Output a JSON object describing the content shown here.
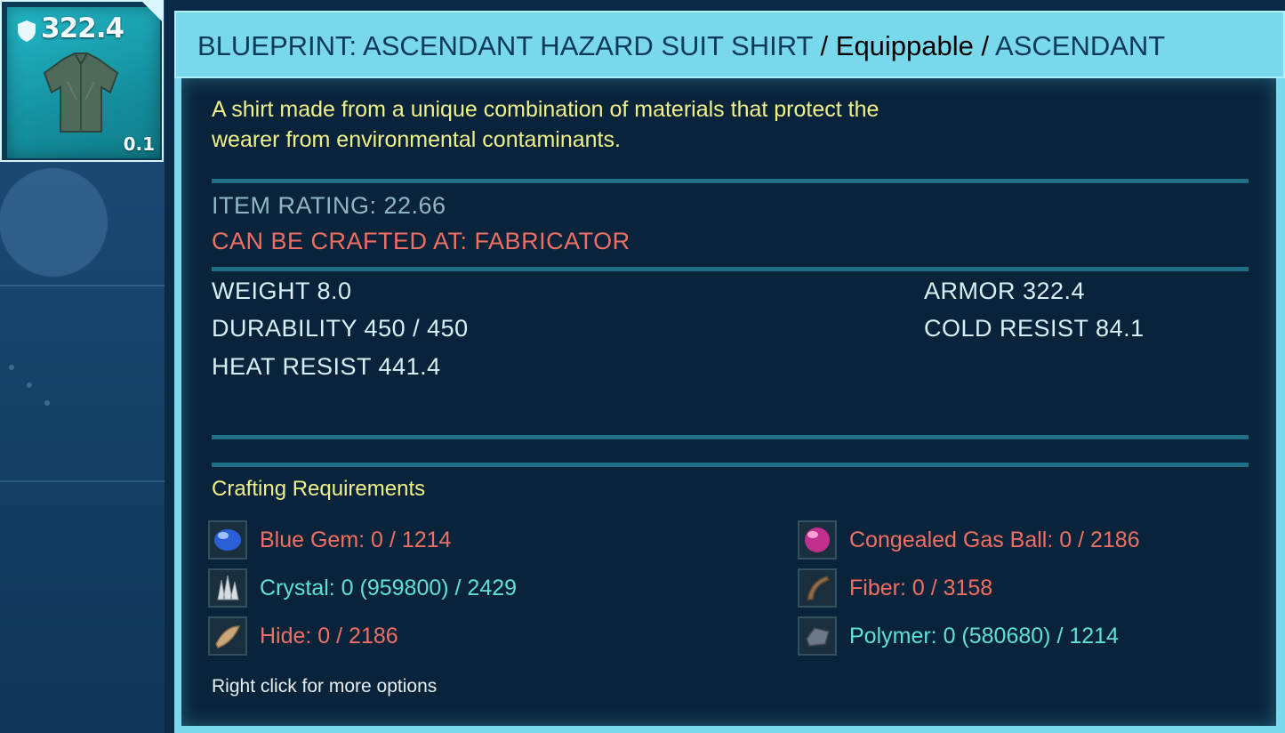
{
  "item_slot": {
    "armor_value": "322.4",
    "weight_value": "0.1",
    "item_icon": "shirt-icon",
    "badge_icon": "shield-icon"
  },
  "tooltip": {
    "title_main": "BLUEPRINT: ASCENDANT HAZARD SUIT SHIRT",
    "title_sep1": " / ",
    "title_type": "Equippable",
    "title_sep2": " / ",
    "title_quality": "ASCENDANT",
    "description_line1": "A shirt made from a unique combination of materials that protect the",
    "description_line2": "wearer from environmental contaminants.",
    "item_rating": "ITEM RATING: 22.66",
    "crafted_at": "CAN BE CRAFTED AT: FABRICATOR",
    "stats": {
      "weight": "WEIGHT 8.0",
      "durability": "DURABILITY 450 / 450",
      "heat_resist": "HEAT RESIST 441.4",
      "armor": "ARMOR 322.4",
      "cold_resist": "COLD RESIST 84.1"
    },
    "crafting_title": "Crafting Requirements",
    "requirements": [
      {
        "label": "Blue Gem: 0 / 1214",
        "icon": "blue-gem-icon",
        "status": "missing"
      },
      {
        "label": "Congealed Gas Ball: 0 / 2186",
        "icon": "gas-ball-icon",
        "status": "missing"
      },
      {
        "label": "Crystal: 0 (959800) / 2429",
        "icon": "crystal-icon",
        "status": "available"
      },
      {
        "label": "Fiber: 0 / 3158",
        "icon": "fiber-icon",
        "status": "missing"
      },
      {
        "label": "Hide: 0 / 2186",
        "icon": "hide-icon",
        "status": "missing"
      },
      {
        "label": "Polymer: 0 (580680) / 1214",
        "icon": "polymer-icon",
        "status": "available"
      }
    ],
    "hint": "Right click for more options"
  },
  "colors": {
    "title_bar": "#7ad8ec",
    "title_text": "#0b3a5a",
    "description": "#f1f18a",
    "missing": "#ef6f62",
    "available": "#5fe0d6",
    "rating": "#8fb5c7"
  }
}
